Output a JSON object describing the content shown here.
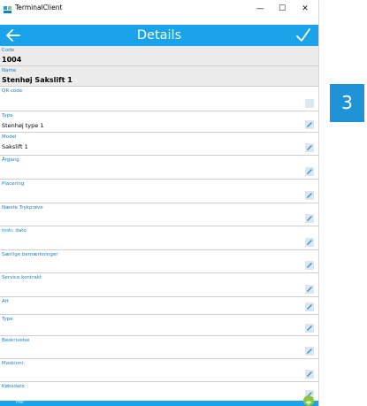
{
  "window": {
    "title": "TerminalClient",
    "minimize": "—",
    "maximize": "☐",
    "close": "✕"
  },
  "appbar": {
    "title": "Details"
  },
  "fields": [
    {
      "label": "Code",
      "value": "1004"
    },
    {
      "label": "Name",
      "value": "Stenhøj Sakslift 1"
    },
    {
      "label": "QR code",
      "value": ""
    },
    {
      "label": "Type",
      "value": "Stenhøj type 1"
    },
    {
      "label": "Model",
      "value": "Sakslift 1"
    },
    {
      "label": "Årgang",
      "value": ""
    },
    {
      "label": "Placering",
      "value": ""
    },
    {
      "label": "Næste Trykprøve",
      "value": ""
    },
    {
      "label": "Instr. dato",
      "value": ""
    },
    {
      "label": "Særlige bemærkninger",
      "value": ""
    },
    {
      "label": "Service kontrakt",
      "value": ""
    },
    {
      "label": "Art",
      "value": ""
    },
    {
      "label": "Type",
      "value": ""
    },
    {
      "label": "Beskrivelse",
      "value": ""
    },
    {
      "label": "Maskinnr.",
      "value": ""
    },
    {
      "label": "Købsdato",
      "value": ""
    }
  ],
  "bottombar": {
    "label": "Pos"
  },
  "badge": {
    "text": "3"
  },
  "colors": {
    "accent": "#1aa3e8",
    "label": "#1a7fc1",
    "badge": "#1f93d6"
  }
}
